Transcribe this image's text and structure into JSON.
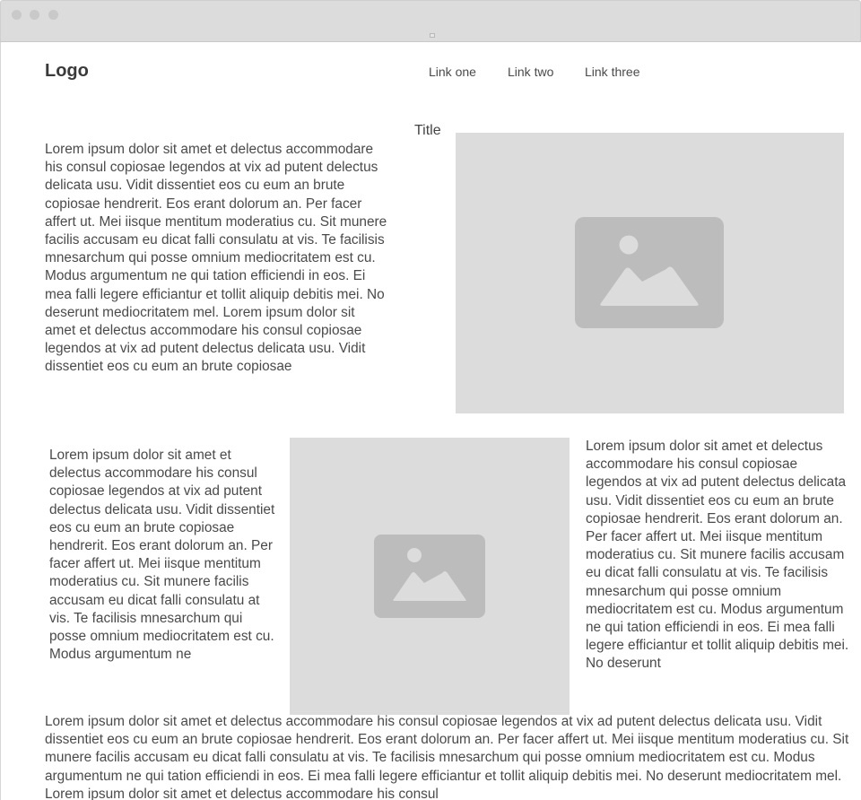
{
  "browser": {
    "controls": [
      "close-dot",
      "minimize-dot",
      "maximize-dot"
    ]
  },
  "header": {
    "logo": "Logo",
    "nav": [
      "Link one",
      "Link two",
      "Link three"
    ]
  },
  "hero": {
    "title": "Title",
    "text": "Lorem ipsum dolor sit amet et delectus accommodare his consul copiosae legendos at vix ad putent delectus delicata usu. Vidit dissentiet eos cu eum an brute copiosae hendrerit. Eos erant dolorum an. Per facer affert ut. Mei iisque mentitum moderatius cu. Sit munere facilis accusam eu dicat falli consulatu at vis. Te facilisis mnesarchum qui posse omnium mediocritatem est cu. Modus argumentum ne qui tation efficiendi in eos. Ei mea falli legere efficiantur et tollit aliquip debitis mei. No deserunt mediocritatem mel. Lorem ipsum dolor sit amet et delectus accommodare his consul copiosae legendos at vix ad putent delectus delicata usu. Vidit dissentiet eos cu eum an brute copiosae",
    "image_icon": "image-placeholder-icon"
  },
  "middle": {
    "left_text": "Lorem ipsum dolor sit amet et delectus accommodare his consul copiosae legendos at vix ad putent delectus delicata usu. Vidit dissentiet eos cu eum an brute copiosae hendrerit. Eos erant dolorum an. Per facer affert ut. Mei iisque mentitum moderatius cu. Sit munere facilis accusam eu dicat falli consulatu at vis. Te facilisis mnesarchum qui posse omnium mediocritatem est cu. Modus argumentum ne",
    "image_icon": "image-placeholder-icon",
    "right_text": "Lorem ipsum dolor sit amet et delectus accommodare his consul copiosae legendos at vix ad putent delectus delicata usu. Vidit dissentiet eos cu eum an brute copiosae hendrerit. Eos erant dolorum an. Per facer affert ut. Mei iisque mentitum moderatius cu. Sit munere facilis accusam eu dicat falli consulatu at vis. Te facilisis mnesarchum qui posse omnium mediocritatem est cu. Modus argumentum ne qui tation efficiendi in eos. Ei mea falli legere efficiantur et tollit aliquip debitis mei. No deserunt"
  },
  "footer_text": "Lorem ipsum dolor sit amet et delectus accommodare his consul copiosae legendos at vix ad putent delectus delicata usu. Vidit dissentiet eos cu eum an brute copiosae hendrerit. Eos erant dolorum an. Per facer affert ut. Mei iisque mentitum moderatius cu. Sit munere facilis accusam eu dicat falli consulatu at vis. Te facilisis mnesarchum qui posse omnium mediocritatem est cu. Modus argumentum ne qui tation efficiendi in eos. Ei mea falli legere efficiantur et tollit aliquip debitis mei. No deserunt mediocritatem mel. Lorem ipsum dolor sit amet et delectus accommodare his consul",
  "colors": {
    "placeholder_bg": "#dcdcdc",
    "placeholder_icon": "#bcbcbc",
    "chrome_bg": "#dcdcdc"
  }
}
